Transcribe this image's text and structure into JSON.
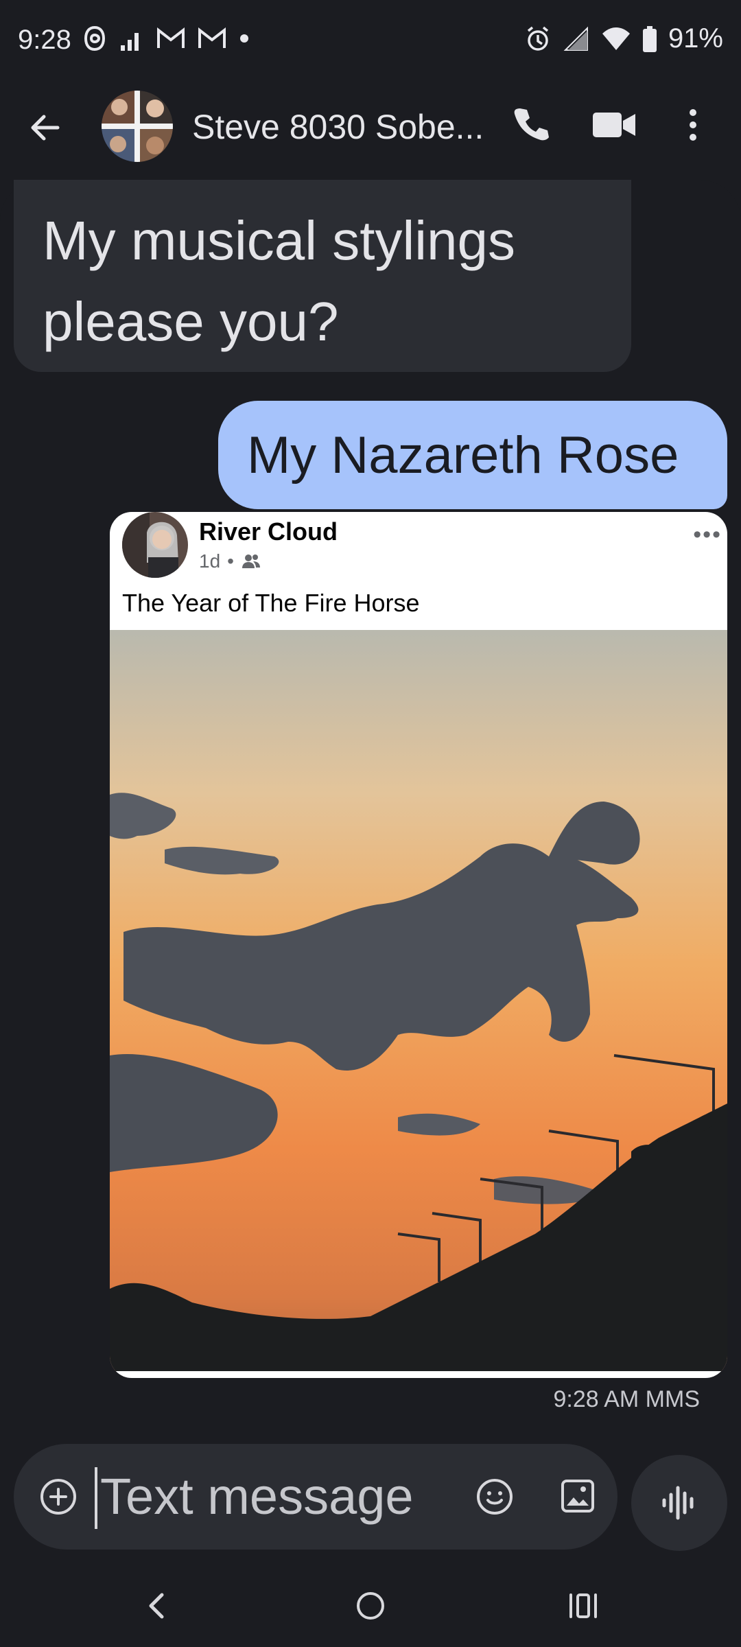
{
  "status_bar": {
    "time": "9:28",
    "battery_percent": "91%",
    "notification_icons": [
      "threads-icon",
      "signal-icon",
      "gmail-icon",
      "gmail-icon",
      "dot-icon"
    ],
    "system_icons": [
      "alarm-icon",
      "cell-signal-icon",
      "wifi-icon",
      "battery-icon"
    ]
  },
  "app_bar": {
    "contact_name": "Steve 8030 Sobe...",
    "actions": [
      "back-arrow-icon",
      "phone-icon",
      "video-icon",
      "more-vert-icon"
    ]
  },
  "messages": [
    {
      "direction": "incoming",
      "text": "My musical stylings please you?"
    },
    {
      "direction": "outgoing",
      "text": "My Nazareth Rose"
    }
  ],
  "shared_post": {
    "author": "River Cloud",
    "age": "1d",
    "audience_icon": "friends-icon",
    "caption": "The Year of The Fire Horse",
    "more_label": "•••"
  },
  "message_meta": {
    "timestamp": "9:28 AM",
    "type": "MMS"
  },
  "composer": {
    "placeholder": "Text message"
  },
  "colors": {
    "background": "#1b1c21",
    "incoming_bubble": "#2b2d33",
    "outgoing_bubble": "#a6c3fb",
    "card_background": "#ffffff"
  }
}
